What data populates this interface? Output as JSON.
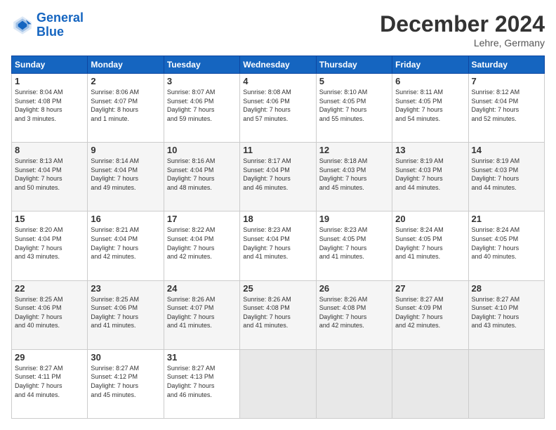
{
  "header": {
    "logo_line1": "General",
    "logo_line2": "Blue",
    "month_year": "December 2024",
    "location": "Lehre, Germany"
  },
  "days_of_week": [
    "Sunday",
    "Monday",
    "Tuesday",
    "Wednesday",
    "Thursday",
    "Friday",
    "Saturday"
  ],
  "weeks": [
    [
      {
        "day": "1",
        "lines": [
          "Sunrise: 8:04 AM",
          "Sunset: 4:08 PM",
          "Daylight: 8 hours",
          "and 3 minutes."
        ]
      },
      {
        "day": "2",
        "lines": [
          "Sunrise: 8:06 AM",
          "Sunset: 4:07 PM",
          "Daylight: 8 hours",
          "and 1 minute."
        ]
      },
      {
        "day": "3",
        "lines": [
          "Sunrise: 8:07 AM",
          "Sunset: 4:06 PM",
          "Daylight: 7 hours",
          "and 59 minutes."
        ]
      },
      {
        "day": "4",
        "lines": [
          "Sunrise: 8:08 AM",
          "Sunset: 4:06 PM",
          "Daylight: 7 hours",
          "and 57 minutes."
        ]
      },
      {
        "day": "5",
        "lines": [
          "Sunrise: 8:10 AM",
          "Sunset: 4:05 PM",
          "Daylight: 7 hours",
          "and 55 minutes."
        ]
      },
      {
        "day": "6",
        "lines": [
          "Sunrise: 8:11 AM",
          "Sunset: 4:05 PM",
          "Daylight: 7 hours",
          "and 54 minutes."
        ]
      },
      {
        "day": "7",
        "lines": [
          "Sunrise: 8:12 AM",
          "Sunset: 4:04 PM",
          "Daylight: 7 hours",
          "and 52 minutes."
        ]
      }
    ],
    [
      {
        "day": "8",
        "lines": [
          "Sunrise: 8:13 AM",
          "Sunset: 4:04 PM",
          "Daylight: 7 hours",
          "and 50 minutes."
        ]
      },
      {
        "day": "9",
        "lines": [
          "Sunrise: 8:14 AM",
          "Sunset: 4:04 PM",
          "Daylight: 7 hours",
          "and 49 minutes."
        ]
      },
      {
        "day": "10",
        "lines": [
          "Sunrise: 8:16 AM",
          "Sunset: 4:04 PM",
          "Daylight: 7 hours",
          "and 48 minutes."
        ]
      },
      {
        "day": "11",
        "lines": [
          "Sunrise: 8:17 AM",
          "Sunset: 4:04 PM",
          "Daylight: 7 hours",
          "and 46 minutes."
        ]
      },
      {
        "day": "12",
        "lines": [
          "Sunrise: 8:18 AM",
          "Sunset: 4:03 PM",
          "Daylight: 7 hours",
          "and 45 minutes."
        ]
      },
      {
        "day": "13",
        "lines": [
          "Sunrise: 8:19 AM",
          "Sunset: 4:03 PM",
          "Daylight: 7 hours",
          "and 44 minutes."
        ]
      },
      {
        "day": "14",
        "lines": [
          "Sunrise: 8:19 AM",
          "Sunset: 4:03 PM",
          "Daylight: 7 hours",
          "and 44 minutes."
        ]
      }
    ],
    [
      {
        "day": "15",
        "lines": [
          "Sunrise: 8:20 AM",
          "Sunset: 4:04 PM",
          "Daylight: 7 hours",
          "and 43 minutes."
        ]
      },
      {
        "day": "16",
        "lines": [
          "Sunrise: 8:21 AM",
          "Sunset: 4:04 PM",
          "Daylight: 7 hours",
          "and 42 minutes."
        ]
      },
      {
        "day": "17",
        "lines": [
          "Sunrise: 8:22 AM",
          "Sunset: 4:04 PM",
          "Daylight: 7 hours",
          "and 42 minutes."
        ]
      },
      {
        "day": "18",
        "lines": [
          "Sunrise: 8:23 AM",
          "Sunset: 4:04 PM",
          "Daylight: 7 hours",
          "and 41 minutes."
        ]
      },
      {
        "day": "19",
        "lines": [
          "Sunrise: 8:23 AM",
          "Sunset: 4:05 PM",
          "Daylight: 7 hours",
          "and 41 minutes."
        ]
      },
      {
        "day": "20",
        "lines": [
          "Sunrise: 8:24 AM",
          "Sunset: 4:05 PM",
          "Daylight: 7 hours",
          "and 41 minutes."
        ]
      },
      {
        "day": "21",
        "lines": [
          "Sunrise: 8:24 AM",
          "Sunset: 4:05 PM",
          "Daylight: 7 hours",
          "and 40 minutes."
        ]
      }
    ],
    [
      {
        "day": "22",
        "lines": [
          "Sunrise: 8:25 AM",
          "Sunset: 4:06 PM",
          "Daylight: 7 hours",
          "and 40 minutes."
        ]
      },
      {
        "day": "23",
        "lines": [
          "Sunrise: 8:25 AM",
          "Sunset: 4:06 PM",
          "Daylight: 7 hours",
          "and 41 minutes."
        ]
      },
      {
        "day": "24",
        "lines": [
          "Sunrise: 8:26 AM",
          "Sunset: 4:07 PM",
          "Daylight: 7 hours",
          "and 41 minutes."
        ]
      },
      {
        "day": "25",
        "lines": [
          "Sunrise: 8:26 AM",
          "Sunset: 4:08 PM",
          "Daylight: 7 hours",
          "and 41 minutes."
        ]
      },
      {
        "day": "26",
        "lines": [
          "Sunrise: 8:26 AM",
          "Sunset: 4:08 PM",
          "Daylight: 7 hours",
          "and 42 minutes."
        ]
      },
      {
        "day": "27",
        "lines": [
          "Sunrise: 8:27 AM",
          "Sunset: 4:09 PM",
          "Daylight: 7 hours",
          "and 42 minutes."
        ]
      },
      {
        "day": "28",
        "lines": [
          "Sunrise: 8:27 AM",
          "Sunset: 4:10 PM",
          "Daylight: 7 hours",
          "and 43 minutes."
        ]
      }
    ],
    [
      {
        "day": "29",
        "lines": [
          "Sunrise: 8:27 AM",
          "Sunset: 4:11 PM",
          "Daylight: 7 hours",
          "and 44 minutes."
        ]
      },
      {
        "day": "30",
        "lines": [
          "Sunrise: 8:27 AM",
          "Sunset: 4:12 PM",
          "Daylight: 7 hours",
          "and 45 minutes."
        ]
      },
      {
        "day": "31",
        "lines": [
          "Sunrise: 8:27 AM",
          "Sunset: 4:13 PM",
          "Daylight: 7 hours",
          "and 46 minutes."
        ]
      },
      null,
      null,
      null,
      null
    ]
  ]
}
